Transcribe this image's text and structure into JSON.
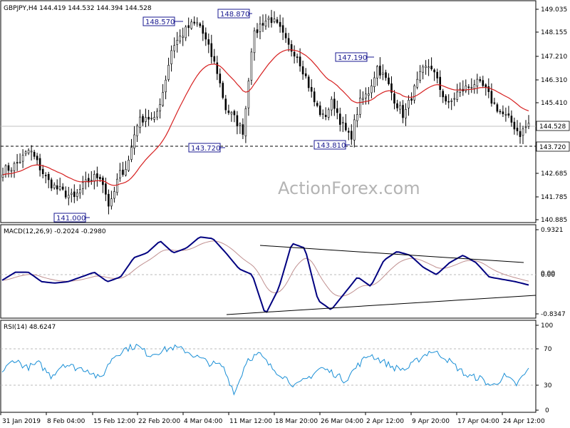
{
  "chart_data": [
    {
      "type": "candlestick",
      "header": "GBPJPY,H4  144.419 144.532 144.394 144.528",
      "watermark": "ActionForex.com",
      "ylim": [
        140.6,
        149.25
      ],
      "y_ticks": [
        "149.035",
        "148.155",
        "147.210",
        "146.310",
        "145.410",
        "144.528",
        "143.720",
        "142.685",
        "141.785",
        "140.885"
      ],
      "last_price": "144.528",
      "support_level": "143.720",
      "ma_series": "red moving average",
      "peak_labels": [
        "148.570",
        "148.870",
        "147.190"
      ],
      "trough_labels": [
        "141.000",
        "143.720",
        "143.810"
      ],
      "close_approx": [
        142.8,
        142.9,
        143.2,
        143.6,
        143.0,
        142.4,
        142.1,
        141.9,
        141.7,
        142.2,
        142.5,
        142.6,
        141.3,
        142.6,
        143.0,
        144.6,
        144.9,
        144.7,
        145.9,
        147.6,
        148.0,
        148.4,
        148.5,
        147.6,
        146.7,
        145.2,
        144.8,
        144.3,
        147.9,
        148.5,
        148.7,
        148.3,
        147.6,
        147.3,
        146.4,
        145.4,
        144.8,
        145.5,
        144.6,
        144.0,
        145.4,
        145.8,
        146.8,
        146.3,
        145.5,
        144.9,
        145.8,
        146.6,
        146.9,
        146.0,
        145.3,
        145.8,
        146.0,
        146.2,
        146.0,
        145.4,
        145.0,
        144.7,
        144.2,
        144.6
      ],
      "colors": {
        "candle": "#000000",
        "ma": "#d62020",
        "label_border": "#1a1a90",
        "label_text": "#1a1a90"
      }
    },
    {
      "type": "line",
      "header": "MACD(12,26,9) -0.2024 -0.2980",
      "ylim": [
        -0.95,
        1.0
      ],
      "y_ticks": [
        "0.9321",
        "0.00",
        "0.00",
        "-0.8347"
      ],
      "macd_approx": [
        -0.12,
        0.05,
        0.05,
        -0.15,
        -0.18,
        -0.15,
        -0.05,
        0.05,
        -0.15,
        -0.05,
        0.35,
        0.45,
        0.7,
        0.45,
        0.55,
        0.78,
        0.75,
        0.45,
        0.12,
        0.0,
        -0.85,
        -0.3,
        0.65,
        0.55,
        -0.55,
        -0.75,
        -0.4,
        -0.05,
        -0.25,
        0.3,
        0.48,
        0.4,
        0.15,
        0.0,
        0.25,
        0.4,
        0.25,
        -0.05,
        -0.1,
        -0.15,
        -0.22
      ],
      "colors": {
        "macd": "#000080",
        "signal": "#c09090",
        "trend": "#000000"
      }
    },
    {
      "type": "line",
      "header": "RSI(14) 48.6247",
      "ylim": [
        0,
        100
      ],
      "y_ticks": [
        "100",
        "70",
        "30",
        "0"
      ],
      "levels": [
        70,
        30
      ],
      "rsi_approx": [
        45,
        60,
        50,
        55,
        40,
        55,
        50,
        48,
        36,
        62,
        72,
        76,
        65,
        70,
        74,
        70,
        62,
        55,
        52,
        20,
        60,
        66,
        50,
        40,
        28,
        38,
        50,
        44,
        35,
        52,
        66,
        58,
        50,
        48,
        60,
        70,
        64,
        52,
        40,
        38,
        28,
        40,
        30,
        48
      ],
      "colors": {
        "rsi": "#1a8fd6"
      }
    }
  ],
  "x_axis": {
    "labels": [
      "31 Jan 2019",
      "8 Feb 04:00",
      "15 Feb 12:00",
      "22 Feb 20:00",
      "4 Mar 04:00",
      "11 Mar 12:00",
      "18 Mar 20:00",
      "26 Mar 04:00",
      "2 Apr 12:00",
      "9 Apr 20:00",
      "17 Apr 04:00",
      "24 Apr 12:00"
    ]
  }
}
